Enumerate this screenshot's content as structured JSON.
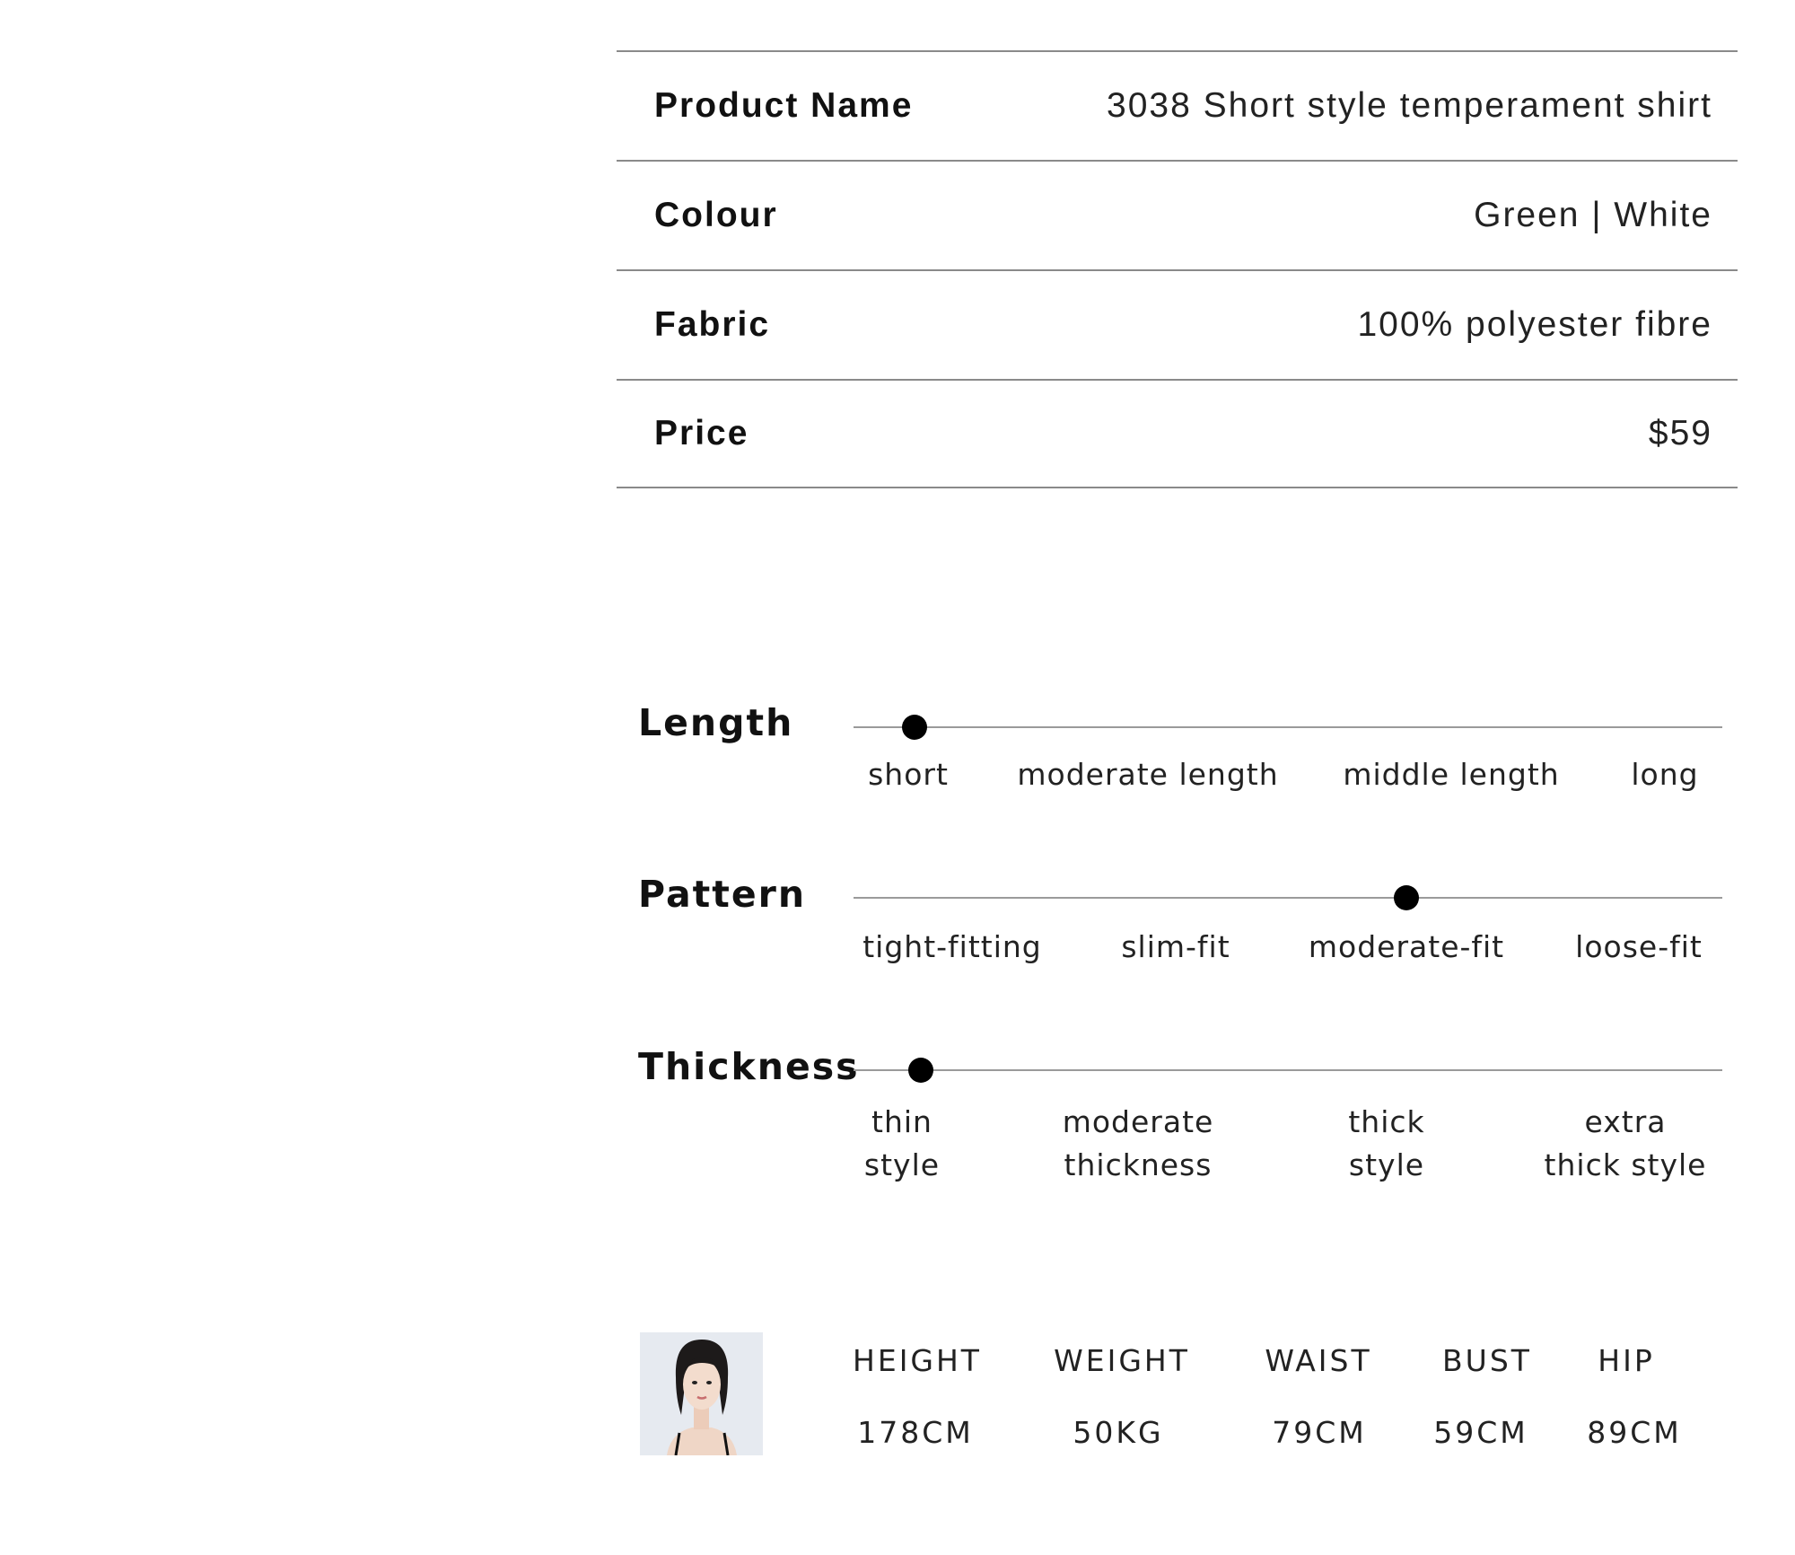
{
  "specs": {
    "rows": [
      {
        "label": "Product Name",
        "value": "3038 Short style temperament shirt"
      },
      {
        "label": "Colour",
        "value": "Green | White"
      },
      {
        "label": "Fabric",
        "value": "100% polyester fibre"
      },
      {
        "label": "Price",
        "value": "$59"
      }
    ]
  },
  "attributes": {
    "length": {
      "title": "Length",
      "options": [
        "short",
        "moderate length",
        "middle length",
        "long"
      ],
      "selected_index": 0
    },
    "pattern": {
      "title": "Pattern",
      "options": [
        "tight-fitting",
        "slim-fit",
        "moderate-fit",
        "loose-fit"
      ],
      "selected_index": 2
    },
    "thickness": {
      "title": "Thickness",
      "options": [
        "thin\nstyle",
        "moderate\nthickness",
        "thick\nstyle",
        "extra\nthick style"
      ],
      "selected_index": 0
    }
  },
  "model": {
    "photo_icon": "model-portrait",
    "measurements": [
      {
        "label": "HEIGHT",
        "value": "178CM"
      },
      {
        "label": "WEIGHT",
        "value": "50KG"
      },
      {
        "label": "WAIST",
        "value": "79CM"
      },
      {
        "label": "BUST",
        "value": "59CM"
      },
      {
        "label": "HIP",
        "value": "89CM"
      }
    ]
  },
  "colors": {
    "rule": "#8a8a8a",
    "dot": "#000000",
    "text": "#111111"
  }
}
